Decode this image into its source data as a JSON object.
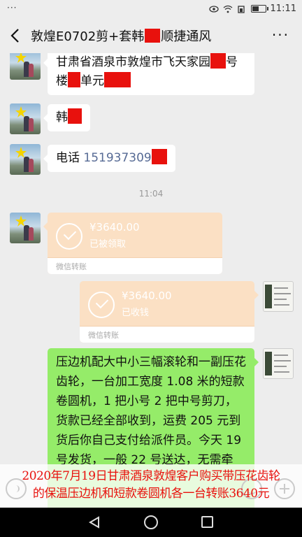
{
  "status_bar": {
    "dots": "···",
    "time": "11:11"
  },
  "header": {
    "title_prefix": "敦煌E0702剪+套韩",
    "title_suffix": "顺捷通风",
    "more_label": "···"
  },
  "messages": {
    "address_line1": "甘肃省酒泉市敦煌市飞天家园",
    "address_line1_tail": "号",
    "address_line2a": "楼",
    "address_line2b": "单元",
    "name_text": "韩",
    "phone_label": "电话",
    "phone_number": "151937309",
    "timestamp": "11:04",
    "transfer_received": {
      "amount": "¥3640.00",
      "status": "已被领取",
      "footer": "微信转账"
    },
    "transfer_sent": {
      "amount": "¥3640.00",
      "status": "已收钱",
      "footer": "微信转账"
    },
    "long_message": "压边机配大中小三幅滚轮和一副压花齿轮，一台加工宽度 1.08 米的短款卷圆机，1 把小号 2 把中号剪刀，货款已经全部收到，运费 205 元到货后你自己支付给派件员。今天 19 号发货，一般 22 号送达，无需牵"
  },
  "caption": {
    "line1": "2020年7月19日甘肃酒泉敦煌客户购买带压花齿轮",
    "line2": "的保温压边机和短款卷圆机各一台转账3640元"
  },
  "colors": {
    "redaction": "#e8110d",
    "transfer_bg": "#fbe0c4",
    "my_bubble": "#95ec69",
    "link": "#576b95"
  }
}
